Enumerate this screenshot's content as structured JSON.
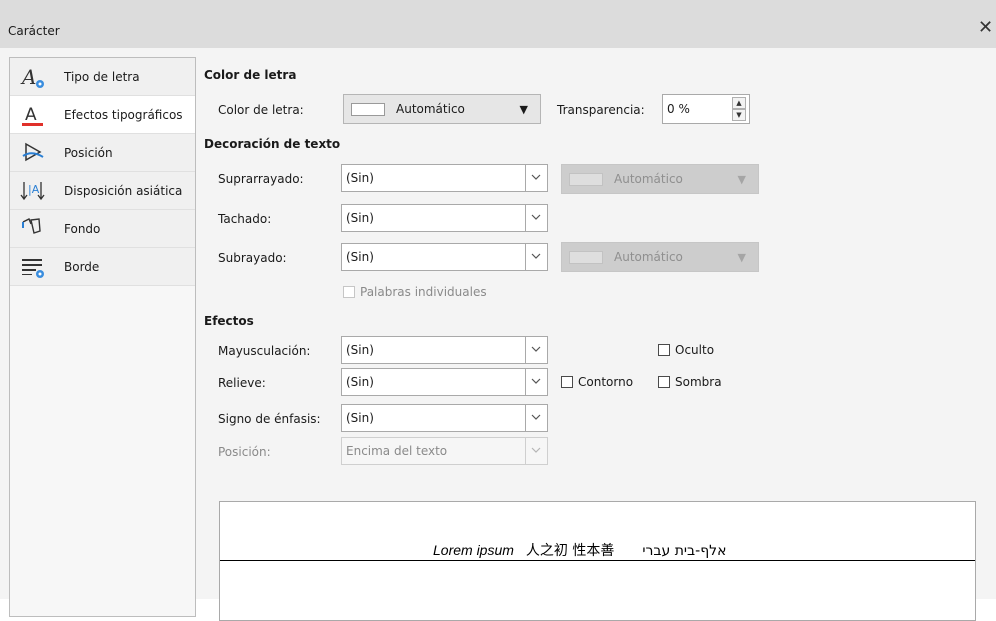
{
  "window": {
    "title": "Carácter",
    "close_glyph": "✕"
  },
  "sidebar": {
    "items": [
      {
        "label": "Tipo de letra",
        "icon": "font-settings-icon"
      },
      {
        "label": "Efectos tipográficos",
        "icon": "font-effects-icon",
        "active": true
      },
      {
        "label": "Posición",
        "icon": "position-icon"
      },
      {
        "label": "Disposición asiática",
        "icon": "asian-layout-icon"
      },
      {
        "label": "Fondo",
        "icon": "highlight-fill-icon"
      },
      {
        "label": "Borde",
        "icon": "border-icon"
      }
    ]
  },
  "font_color": {
    "section": "Color de letra",
    "label": "Color de letra:",
    "value": "Automático",
    "transparency_label": "Transparencia:",
    "transparency_value": "0 %"
  },
  "decoration": {
    "section": "Decoración de texto",
    "overline": {
      "label": "Suprarrayado:",
      "value": "(Sin)",
      "color": "Automático"
    },
    "strikethrough": {
      "label": "Tachado:",
      "value": "(Sin)"
    },
    "underline": {
      "label": "Subrayado:",
      "value": "(Sin)",
      "color": "Automático"
    },
    "individual_words": "Palabras individuales"
  },
  "effects": {
    "section": "Efectos",
    "case": {
      "label": "Mayusculación:",
      "value": "(Sin)"
    },
    "relief": {
      "label": "Relieve:",
      "value": "(Sin)"
    },
    "emphasis": {
      "label": "Signo de énfasis:",
      "value": "(Sin)"
    },
    "position": {
      "label": "Posición:",
      "value": "Encima del texto"
    },
    "hidden": "Oculto",
    "outline": "Contorno",
    "shadow": "Sombra"
  },
  "preview": {
    "latin": "Lorem ipsum",
    "cjk": "人之初 性本善",
    "ctl": "אלף-בית עברי"
  }
}
